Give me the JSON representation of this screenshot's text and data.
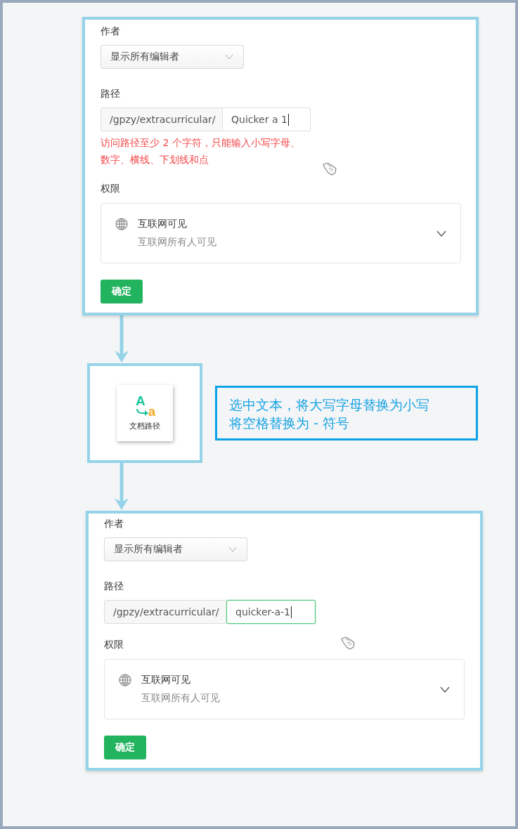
{
  "forms": [
    {
      "author_label": "作者",
      "author_select": "显示所有编辑者",
      "path_label": "路径",
      "path_prefix": "/gpzy/extracurricular/",
      "path_value": "Quicker a 1",
      "focused": false,
      "error": "访问路径至少 2 个字符，只能输入小写字母、数字、横线、下划线和点",
      "permission_label": "权限",
      "permission_title": "互联网可见",
      "permission_subtitle": "互联网所有人可见",
      "confirm": "确定"
    },
    {
      "author_label": "作者",
      "author_select": "显示所有编辑者",
      "path_label": "路径",
      "path_prefix": "/gpzy/extracurricular/",
      "path_value": "quicker-a-1",
      "focused": true,
      "permission_label": "权限",
      "permission_title": "互联网可见",
      "permission_subtitle": "互联网所有人可见",
      "confirm": "确定"
    }
  ],
  "action": {
    "upper": "A",
    "lower": "a",
    "label": "文档路径"
  },
  "note": {
    "lines": [
      "选中文本，将大写字母替换为小写",
      "将空格替换为 - 符号"
    ]
  }
}
